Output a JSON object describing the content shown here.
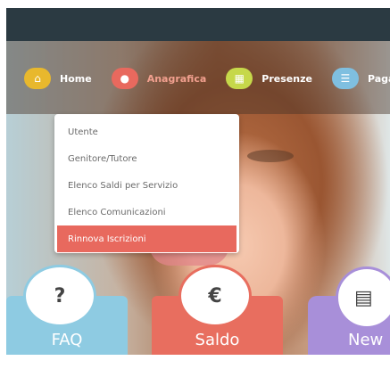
{
  "nav": {
    "items": [
      {
        "label": "Home",
        "icon": "home-icon",
        "color": "#e8b82d",
        "glyph": "⌂",
        "active": false
      },
      {
        "label": "Anagrafica",
        "icon": "user-icon",
        "color": "#e8695e",
        "glyph": "●",
        "active": true
      },
      {
        "label": "Presenze",
        "icon": "calendar-icon",
        "color": "#c6d84a",
        "glyph": "▦",
        "active": false
      },
      {
        "label": "Pagam",
        "icon": "list-icon",
        "color": "#7fbfe0",
        "glyph": "☰",
        "active": false
      }
    ]
  },
  "dropdown": {
    "items": [
      "Utente",
      "Genitore/Tutore",
      "Elenco Saldi per Servizio",
      "Elenco Comunicazioni",
      "Rinnova Iscrizioni"
    ],
    "selected_index": 4
  },
  "tiles": {
    "faq": {
      "label": "FAQ",
      "icon_glyph": "?",
      "icon": "question-icon"
    },
    "saldo": {
      "label": "Saldo",
      "icon_glyph": "€",
      "icon": "euro-icon"
    },
    "news": {
      "label": "New",
      "icon_glyph": "▤",
      "icon": "newspaper-icon"
    }
  },
  "colors": {
    "topbar": "#2b3a42",
    "accent": "#e8695e",
    "faq": "#8ecbe2",
    "saldo": "#e86e5f",
    "news": "#a88fd9"
  }
}
